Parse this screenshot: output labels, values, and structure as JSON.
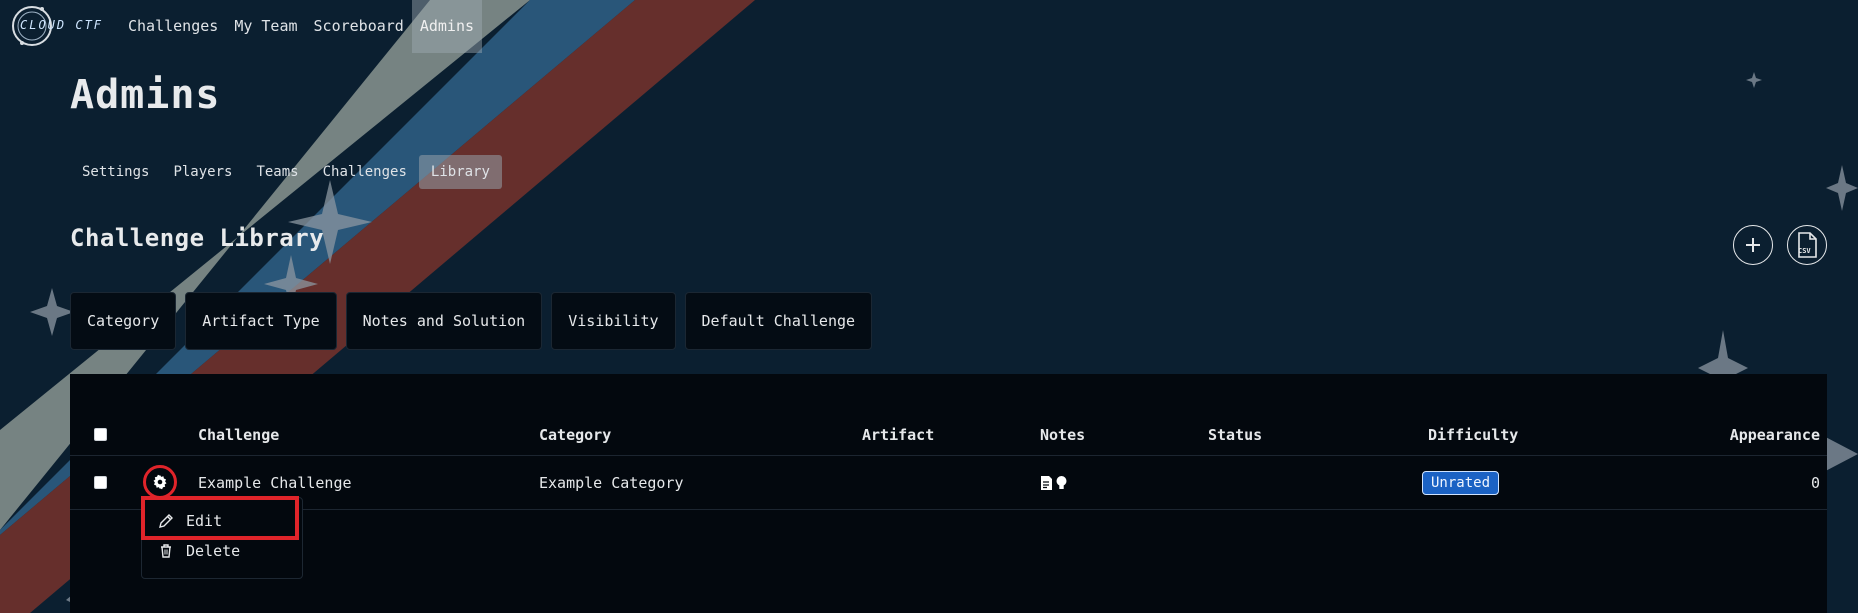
{
  "brand": {
    "name": "CLOUD CTF"
  },
  "nav": {
    "items": [
      "Challenges",
      "My Team",
      "Scoreboard",
      "Admins"
    ],
    "active": "Admins"
  },
  "page": {
    "title": "Admins"
  },
  "subtabs": {
    "items": [
      "Settings",
      "Players",
      "Teams",
      "Challenges",
      "Library"
    ],
    "active": "Library"
  },
  "section": {
    "title": "Challenge Library",
    "add_icon": "plus-icon",
    "csv_icon": "csv-file-icon",
    "csv_label": "CSV"
  },
  "filters": [
    "Category",
    "Artifact Type",
    "Notes and Solution",
    "Visibility",
    "Default Challenge"
  ],
  "table": {
    "columns": [
      "Challenge",
      "Category",
      "Artifact",
      "Notes",
      "Status",
      "Difficulty",
      "Appearance"
    ],
    "rows": [
      {
        "challenge": "Example Challenge",
        "category": "Example Category",
        "artifact": "",
        "notes_icons": [
          "document-icon",
          "lightbulb-icon"
        ],
        "status": "",
        "difficulty": "Unrated",
        "appearance": "0"
      }
    ]
  },
  "row_menu": {
    "items": [
      "Edit",
      "Delete"
    ],
    "icons": [
      "pencil-icon",
      "trash-icon"
    ],
    "highlighted": "Edit"
  },
  "colors": {
    "background": "#0b1f30",
    "stripe_gray": "#8a9591",
    "stripe_blue": "#2b5a7d",
    "stripe_red": "#6b302c",
    "badge": "#1b62c4",
    "highlight": "#e0242a"
  }
}
